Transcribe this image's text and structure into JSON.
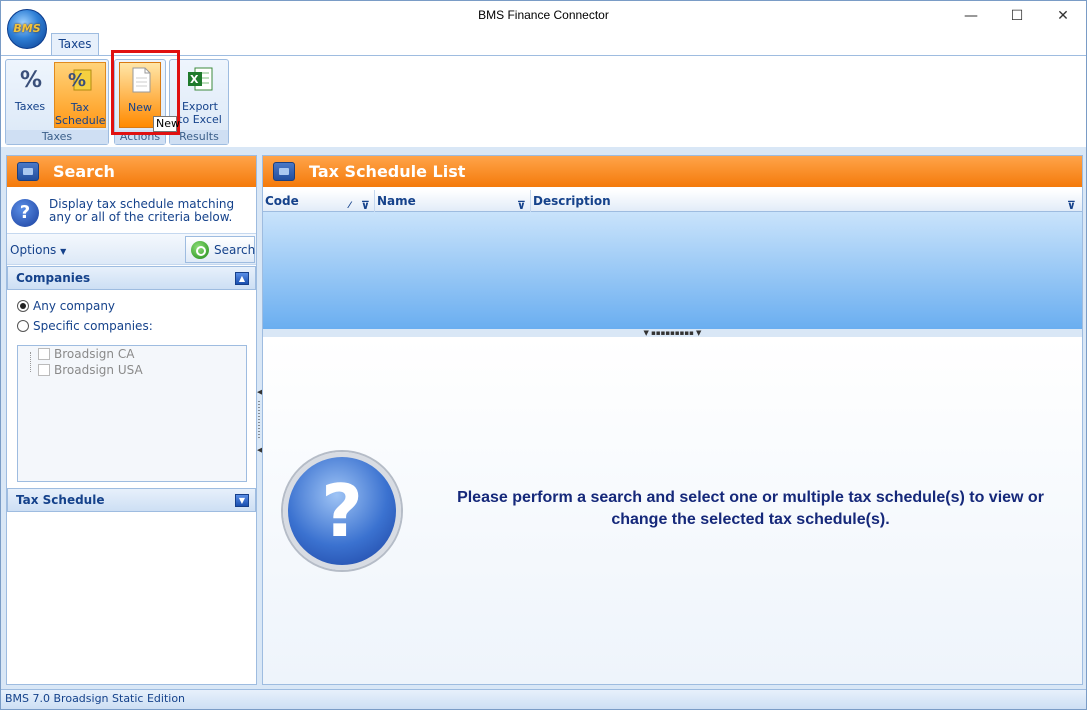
{
  "window": {
    "title": "BMS Finance Connector",
    "minimize": "—",
    "maximize": "☐",
    "close": "✕"
  },
  "app": {
    "orb_text": "BMS"
  },
  "ribbon": {
    "tab": "Taxes",
    "groups": {
      "taxes": "Taxes",
      "actions": "Actions",
      "results": "Results"
    },
    "buttons": {
      "taxes": "Taxes",
      "tax_schedule": "Tax\nSchedule",
      "new": "New",
      "export": "Export\nto Excel"
    },
    "tooltip": "New"
  },
  "search_pane": {
    "title": "Search",
    "info": "Display tax schedule matching any or all of the criteria below.",
    "options": "Options",
    "search_button": "Search",
    "companies_header": "Companies",
    "radio_any": "Any company",
    "radio_specific": "Specific companies:",
    "companies": [
      "Broadsign CA",
      "Broadsign USA"
    ],
    "tax_schedule_header": "Tax Schedule"
  },
  "list_pane": {
    "title": "Tax Schedule List",
    "columns": [
      "Code",
      "Name",
      "Description"
    ],
    "message": "Please perform a search and select one or multiple tax schedule(s) to view or change the selected tax schedule(s)."
  },
  "status": {
    "text": "BMS 7.0 Broadsign Static Edition"
  }
}
